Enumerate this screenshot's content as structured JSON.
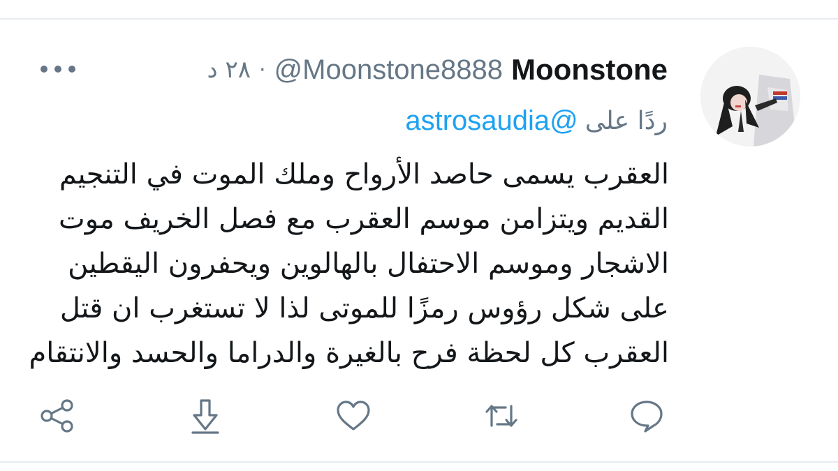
{
  "tweet": {
    "display_name": "Moonstone",
    "handle": "@Moonstone8888",
    "separator": "·",
    "time": "٢٨ د",
    "reply_prefix": "ردًا على",
    "reply_to": "astrosaudia@",
    "lines": [
      "العقرب يسمى حاصد الأرواح وملك الموت في التنجيم",
      "القديم ويتزامن موسم العقرب مع فصل الخريف موت",
      "الاشجار وموسم الاحتفال بالهالوين ويحفرون اليقطين",
      "على شكل رؤوس رمزًا للموتى لذا لا تستغرب ان قتل",
      "العقرب كل لحظة فرح بالغيرة والدراما والحسد والانتقام"
    ]
  },
  "actions": {
    "reply": "reply-icon",
    "retweet": "retweet-icon",
    "like": "heart-icon",
    "save": "download-icon",
    "share": "share-icon"
  },
  "colors": {
    "text": "#14171a",
    "muted": "#657786",
    "link": "#1da1f2",
    "divider": "#e6ecf0"
  }
}
